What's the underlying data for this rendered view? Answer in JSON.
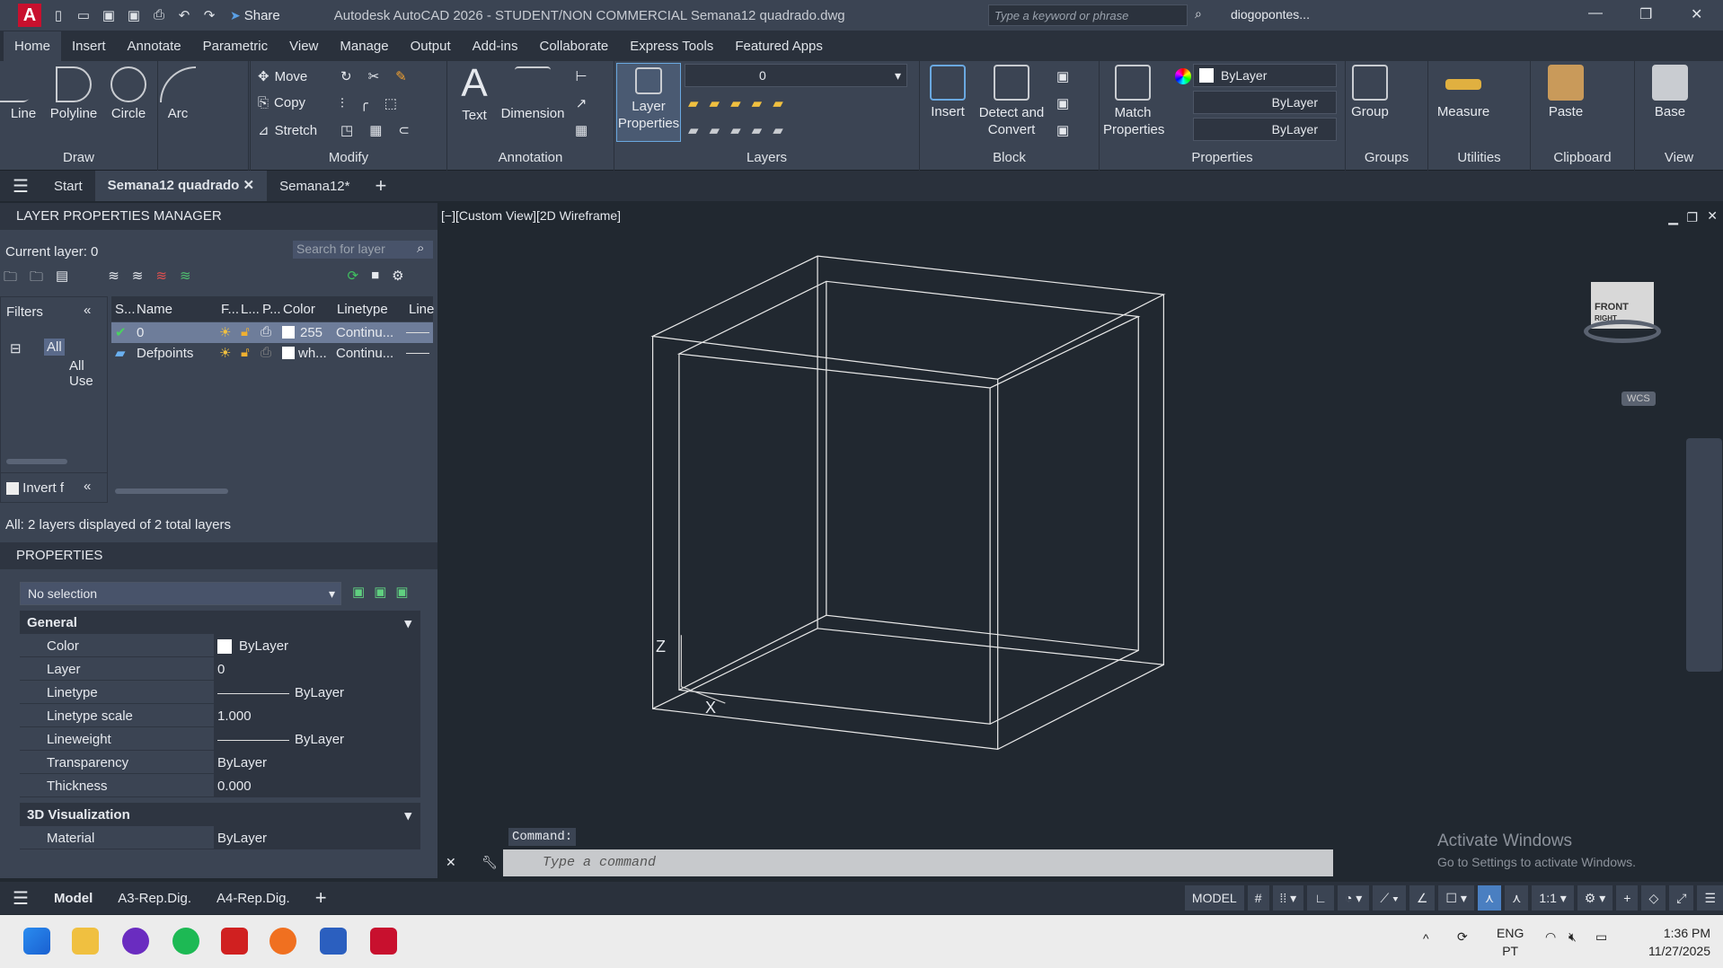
{
  "titlebar": {
    "app_logo": "A",
    "share": "Share",
    "title": "Autodesk AutoCAD 2026 - STUDENT/NON COMMERCIAL    Semana12  quadrado.dwg",
    "search_placeholder": "Type a keyword or phrase",
    "user": "diogopontes..."
  },
  "ribbon_tabs": [
    "Home",
    "Insert",
    "Annotate",
    "Parametric",
    "View",
    "Manage",
    "Output",
    "Add-ins",
    "Collaborate",
    "Express Tools",
    "Featured Apps"
  ],
  "ribbon": {
    "draw": {
      "title": "Draw",
      "line": "Line",
      "polyline": "Polyline",
      "circle": "Circle",
      "arc": "Arc"
    },
    "modify": {
      "title": "Modify",
      "move": "Move",
      "copy": "Copy",
      "stretch": "Stretch"
    },
    "annotation": {
      "title": "Annotation",
      "text": "Text",
      "dimension": "Dimension"
    },
    "layers": {
      "title": "Layers",
      "layer_properties": "Layer Properties",
      "current_layer": "0"
    },
    "block": {
      "title": "Block",
      "insert": "Insert",
      "detect": "Detect and Convert"
    },
    "properties": {
      "title": "Properties",
      "match": "Match Properties",
      "color": "ByLayer",
      "linetype": "ByLayer",
      "lineweight": "ByLayer"
    },
    "groups": {
      "title": "Groups",
      "group": "Group"
    },
    "utilities": {
      "title": "Utilities",
      "measure": "Measure"
    },
    "clipboard": {
      "title": "Clipboard",
      "paste": "Paste"
    },
    "view": {
      "title": "View",
      "base": "Base"
    }
  },
  "file_tabs": [
    "Start",
    "Semana12  quadrado",
    "Semana12*"
  ],
  "layer_manager": {
    "title": "LAYER PROPERTIES MANAGER",
    "current_layer": "Current layer: 0",
    "search_placeholder": "Search for layer",
    "filters": "Filters",
    "tree_all": "All",
    "tree_all_used": "All Use",
    "invert": "Invert f",
    "columns": [
      "S...",
      "Name",
      "F...",
      "L...",
      "P...",
      "Color",
      "Linetype",
      "Line"
    ],
    "layers": [
      {
        "name": "0",
        "color": "255",
        "linetype": "Continu..."
      },
      {
        "name": "Defpoints",
        "color": "wh...",
        "linetype": "Continu..."
      }
    ],
    "status": "All: 2 layers displayed of 2 total layers"
  },
  "properties": {
    "title": "PROPERTIES",
    "selection": "No selection",
    "general": "General",
    "rows": [
      {
        "k": "Color",
        "v": "ByLayer"
      },
      {
        "k": "Layer",
        "v": "0"
      },
      {
        "k": "Linetype",
        "v": "ByLayer"
      },
      {
        "k": "Linetype scale",
        "v": "1.000"
      },
      {
        "k": "Lineweight",
        "v": "ByLayer"
      },
      {
        "k": "Transparency",
        "v": "ByLayer"
      },
      {
        "k": "Thickness",
        "v": "0.000"
      }
    ],
    "viz": "3D Visualization",
    "material_k": "Material",
    "material_v": "ByLayer"
  },
  "viewport": {
    "label": "[−][Custom View][2D Wireframe]",
    "cube_front": "FRONT",
    "cube_right": "RIGHT",
    "wcs": "WCS",
    "axis_z": "Z",
    "axis_x": "X"
  },
  "command": {
    "label": "Command:",
    "placeholder": "Type a command"
  },
  "watermark": {
    "title": "Activate Windows",
    "sub": "Go to Settings to activate Windows."
  },
  "layout_tabs": [
    "Model",
    "A3-Rep.Dig.",
    "A4-Rep.Dig."
  ],
  "status": {
    "model": "MODEL",
    "scale": "1:1"
  },
  "taskbar": {
    "lang1": "ENG",
    "lang2": "PT",
    "time": "1:36 PM",
    "date": "11/27/2025"
  }
}
